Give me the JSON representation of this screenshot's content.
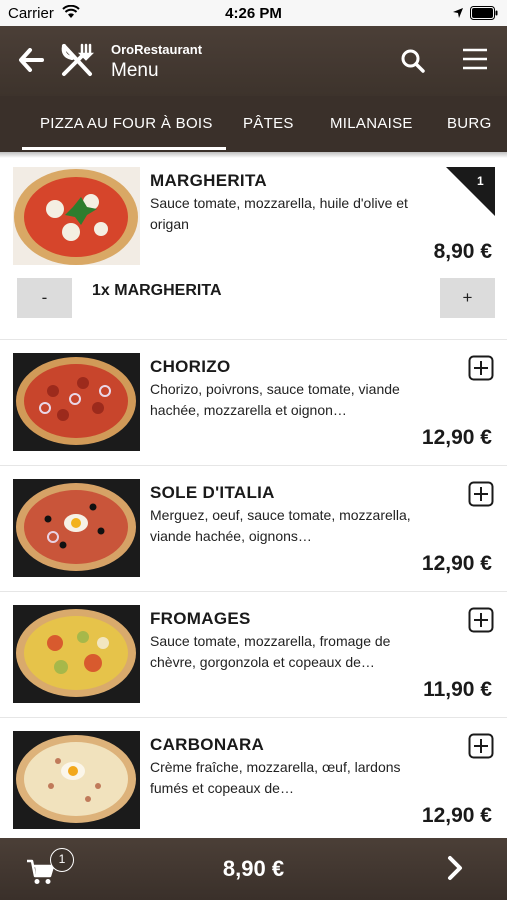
{
  "status_bar": {
    "carrier": "Carrier",
    "time": "4:26 PM"
  },
  "header": {
    "app_name": "OroRestaurant",
    "title": "Menu"
  },
  "tabs": [
    {
      "label": "PIZZA AU FOUR À BOIS",
      "active": true
    },
    {
      "label": "PÂTES"
    },
    {
      "label": "MILANAISE"
    },
    {
      "label": "BURG"
    }
  ],
  "items": [
    {
      "name": "MARGHERITA",
      "description": "Sauce tomate, mozzarella, huile d'olive et origan",
      "price": "8,90 €",
      "in_cart_qty": "1",
      "cart_line": "1x MARGHERITA",
      "minus_label": "-",
      "plus_label": "+"
    },
    {
      "name": "CHORIZO",
      "description": "Chorizo, poivrons, sauce tomate, viande hachée, mozzarella et oignon…",
      "price": "12,90 €"
    },
    {
      "name": "SOLE D'ITALIA",
      "description": "Merguez, oeuf, sauce tomate, mozzarella, viande hachée, oignons…",
      "price": "12,90 €"
    },
    {
      "name": "FROMAGES",
      "description": "Sauce tomate, mozzarella, fromage de chèvre, gorgonzola et copeaux de…",
      "price": "11,90 €"
    },
    {
      "name": "CARBONARA",
      "description": "Crème fraîche, mozzarella, œuf, lardons fumés et copeaux de…",
      "price": "12,90 €"
    }
  ],
  "bottom_bar": {
    "cart_count": "1",
    "total": "8,90 €"
  },
  "colors": {
    "header_bg": "#3d332c",
    "badge_bg": "#1a1a1a",
    "qty_button_bg": "#dcdcdc"
  },
  "icons": {
    "back": "arrow-left-icon",
    "logo": "fork-knife-icon",
    "search": "search-icon",
    "menu": "hamburger-menu-icon",
    "add": "plus-square-icon",
    "cart": "cart-icon",
    "next": "chevron-right-icon"
  }
}
